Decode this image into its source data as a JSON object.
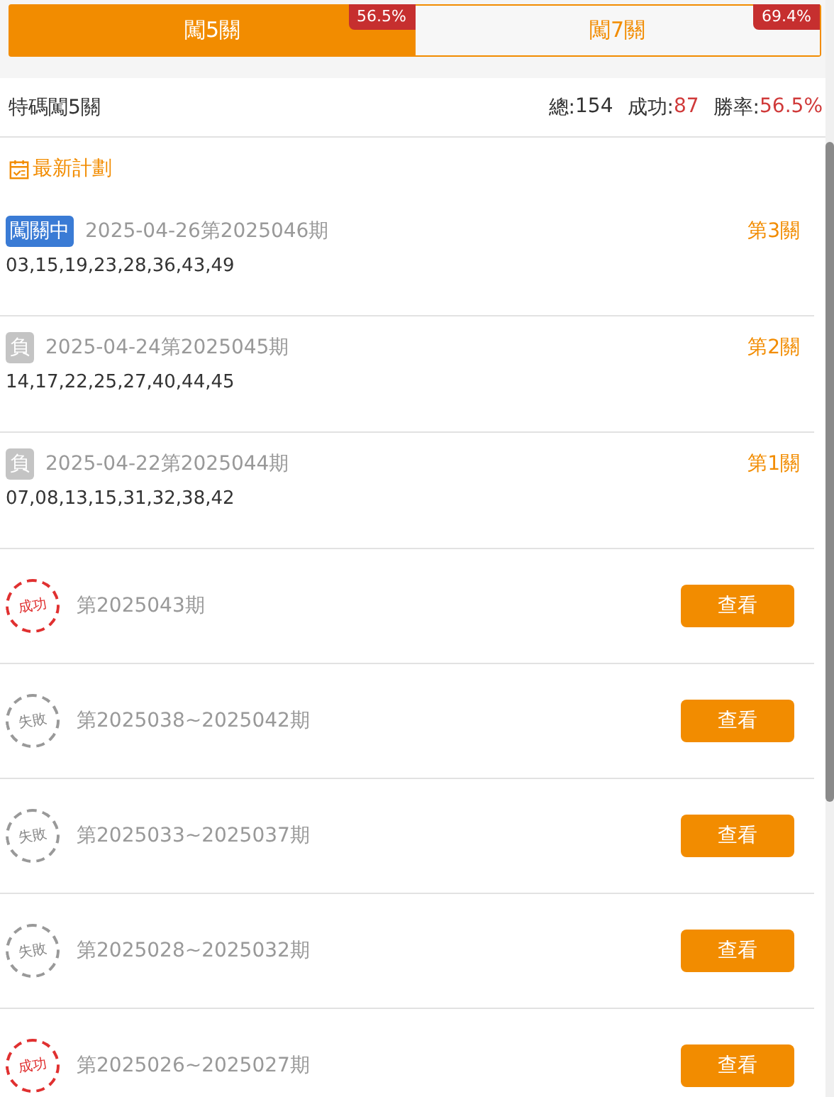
{
  "tabs": [
    {
      "label": "闖5關",
      "rate": "56.5%",
      "selected": true
    },
    {
      "label": "闖7關",
      "rate": "69.4%",
      "selected": false
    }
  ],
  "summary": {
    "title": "特碼闖5關",
    "total_label": "總:",
    "total": "154",
    "success_label": "成功:",
    "success": "87",
    "rate_label": "勝率:",
    "rate": "56.5%"
  },
  "plan_title": "最新計劃",
  "plans": [
    {
      "status": "闖關中",
      "kind": "active",
      "period": "2025-04-26第2025046期",
      "stage": "第3關",
      "numbers": "03,15,19,23,28,36,43,49"
    },
    {
      "status": "負",
      "kind": "lost",
      "period": "2025-04-24第2025045期",
      "stage": "第2關",
      "numbers": "14,17,22,25,27,40,44,45"
    },
    {
      "status": "負",
      "kind": "lost",
      "period": "2025-04-22第2025044期",
      "stage": "第1關",
      "numbers": "07,08,13,15,31,32,38,42"
    }
  ],
  "history": [
    {
      "stamp": "成功",
      "kind": "success",
      "period": "第2025043期",
      "button": "查看"
    },
    {
      "stamp": "失敗",
      "kind": "fail",
      "period": "第2025038~2025042期",
      "button": "查看"
    },
    {
      "stamp": "失敗",
      "kind": "fail",
      "period": "第2025033~2025037期",
      "button": "查看"
    },
    {
      "stamp": "失敗",
      "kind": "fail",
      "period": "第2025028~2025032期",
      "button": "查看"
    },
    {
      "stamp": "成功",
      "kind": "success",
      "period": "第2025026~2025027期",
      "button": "查看"
    }
  ]
}
